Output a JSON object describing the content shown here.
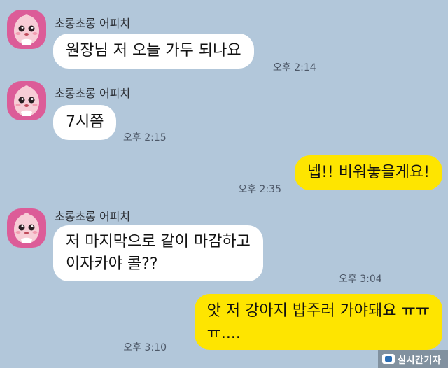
{
  "colors": {
    "background": "#b2c7da",
    "incoming_bubble": "#ffffff",
    "outgoing_bubble": "#fee500",
    "avatar": "#dc5c98"
  },
  "messages": [
    {
      "direction": "incoming",
      "sender": "초롱초롱 어피치",
      "avatar_icon": "apeach-profile-icon",
      "lines": [
        "원장님 저 오늘 가두 되나요"
      ],
      "time": "오후 2:14"
    },
    {
      "direction": "incoming",
      "sender": "초롱초롱 어피치",
      "avatar_icon": "apeach-profile-icon",
      "lines": [
        "7시쯤"
      ],
      "time": "오후 2:15"
    },
    {
      "direction": "outgoing",
      "lines": [
        "넵!! 비워놓을게요!"
      ],
      "time": "오후 2:35"
    },
    {
      "direction": "incoming",
      "sender": "초롱초롱 어피치",
      "avatar_icon": "apeach-profile-icon",
      "lines": [
        "저 마지막으로 같이 마감하고",
        "이자카야 콜??"
      ],
      "time": "오후 3:04"
    },
    {
      "direction": "outgoing",
      "lines": [
        "앗 저 강아지 밥주러 가야돼요 ㅠㅠ",
        "ㅠ...."
      ],
      "time": "오후 3:10"
    }
  ],
  "watermark": {
    "icon": "news-logo-icon",
    "text": "실시간기자"
  }
}
